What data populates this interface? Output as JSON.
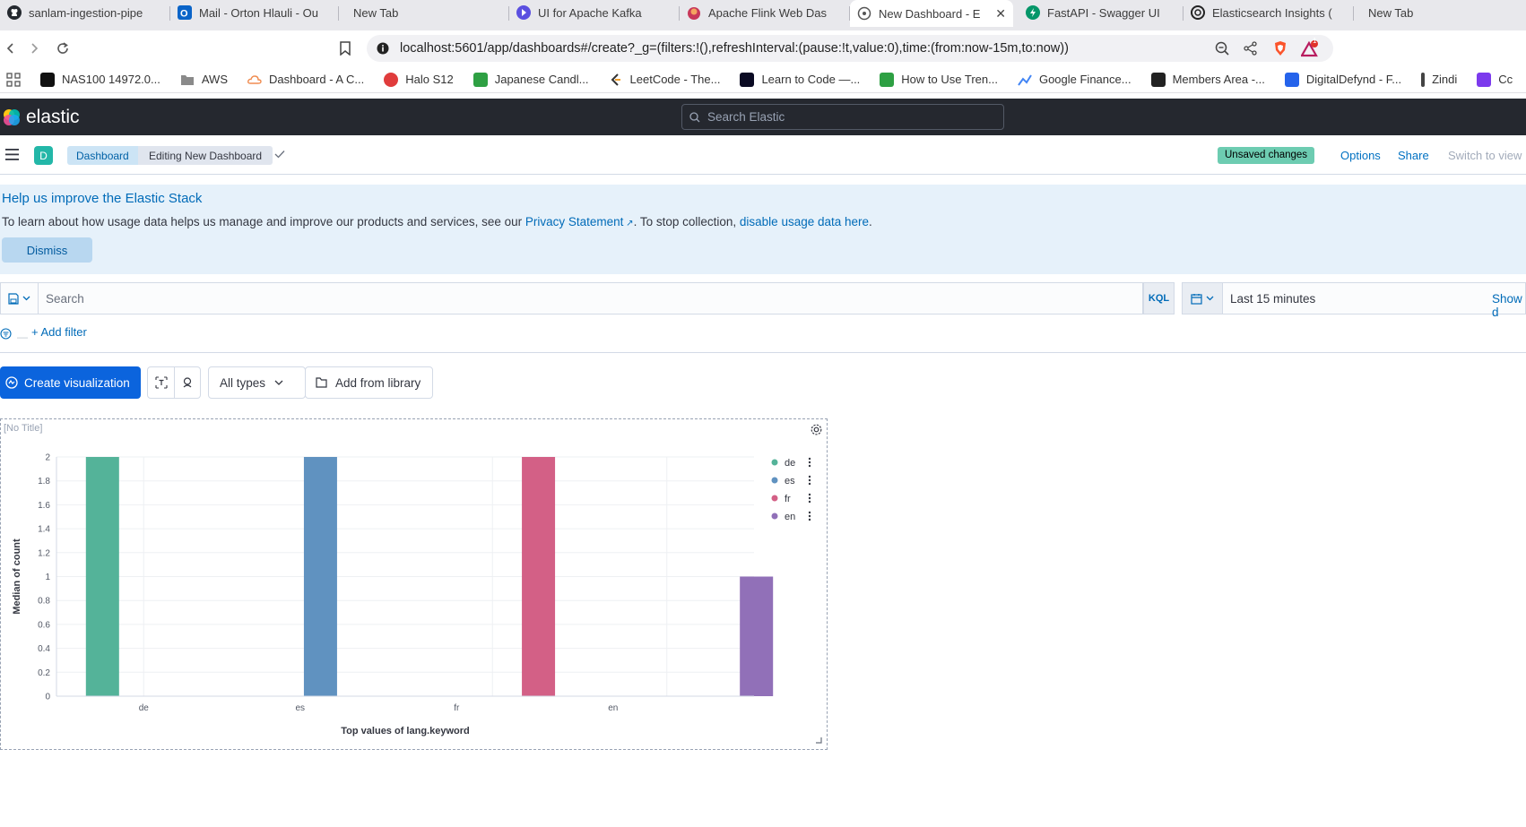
{
  "browser": {
    "tabs": [
      {
        "label": "sanlam-ingestion-pipe",
        "icon": "github-icon",
        "color": "#24292f",
        "active": false
      },
      {
        "label": "Mail - Orton Hlauli - Ou",
        "icon": "outlook-icon",
        "color": "#0a64c8",
        "active": false
      },
      {
        "label": "New Tab",
        "icon": "",
        "color": "",
        "active": false
      },
      {
        "label": "UI for Apache Kafka",
        "icon": "kafka-ui-icon",
        "color": "#5a4fe0",
        "active": false
      },
      {
        "label": "Apache Flink Web Das",
        "icon": "flink-icon",
        "color": "#c8385a",
        "active": false
      },
      {
        "label": "New Dashboard - E",
        "icon": "kibana-icon",
        "color": "#555555",
        "active": true
      },
      {
        "label": "FastAPI - Swagger UI",
        "icon": "fastapi-icon",
        "color": "#059669",
        "active": false
      },
      {
        "label": "Elasticsearch Insights (",
        "icon": "openai-icon",
        "color": "#222222",
        "active": false
      },
      {
        "label": "New Tab",
        "icon": "",
        "color": "",
        "active": false
      }
    ],
    "url": "localhost:5601/app/dashboards#/create?_g=(filters:!(),refreshInterval:(pause:!t,value:0),time:(from:now-15m,to:now))",
    "brave_badge": "1",
    "bookmarks": [
      {
        "label": "NAS100 14972.0...",
        "color": "#111111"
      },
      {
        "label": "AWS",
        "color": "#8a8a8a"
      },
      {
        "label": "Dashboard - A C...",
        "color": "#f08c50"
      },
      {
        "label": "Halo S12",
        "color": "#e03c3c"
      },
      {
        "label": "Japanese Candl...",
        "color": "#2ea043"
      },
      {
        "label": "LeetCode - The...",
        "color": "#333333"
      },
      {
        "label": "Learn to Code —...",
        "color": "#0a0a23"
      },
      {
        "label": "How to Use Tren...",
        "color": "#2ea043"
      },
      {
        "label": "Google Finance...",
        "color": "#4285f4"
      },
      {
        "label": "Members Area -...",
        "color": "#222222"
      },
      {
        "label": "DigitalDefynd - F...",
        "color": "#2563eb"
      },
      {
        "label": "Zindi",
        "color": "#444444"
      },
      {
        "label": "Cc",
        "color": "#7c3aed"
      }
    ]
  },
  "kibana": {
    "logo_text": "elastic",
    "global_search_placeholder": "Search Elastic",
    "space_initial": "D",
    "breadcrumbs": [
      "Dashboard",
      "Editing New Dashboard"
    ],
    "unsaved_badge": "Unsaved changes",
    "header_links": {
      "options": "Options",
      "share": "Share",
      "switch": "Switch to view"
    }
  },
  "callout": {
    "title": "Help us improve the Elastic Stack",
    "body_prefix": "To learn about how usage data helps us manage and improve our products and services, see our ",
    "privacy_link": "Privacy Statement",
    "body_middle": ". To stop collection, ",
    "disable_link": "disable usage data here",
    "body_suffix": ".",
    "dismiss": "Dismiss"
  },
  "query": {
    "placeholder": "Search",
    "language": "KQL",
    "time_range": "Last 15 minutes",
    "show_dates": "Show d",
    "add_filter": "+ Add filter"
  },
  "toolbar": {
    "create_visualization": "Create visualization",
    "all_types": "All types",
    "add_from_library": "Add from library"
  },
  "panel": {
    "title": "[No Title]"
  },
  "chart_data": {
    "type": "bar",
    "categories": [
      "de",
      "es",
      "fr",
      "en"
    ],
    "values": [
      2,
      2,
      2,
      1
    ],
    "colors": [
      "#54b399",
      "#6092c0",
      "#d36086",
      "#9170b8"
    ],
    "legend": [
      "de",
      "es",
      "fr",
      "en"
    ],
    "legend_position": "right",
    "xlabel": "Top values of lang.keyword",
    "ylabel": "Median of count",
    "ylim": [
      0,
      2
    ],
    "yticks": [
      "0",
      "0.2",
      "0.4",
      "0.6",
      "0.8",
      "1",
      "1.2",
      "1.4",
      "1.6",
      "1.8",
      "2"
    ],
    "grid": true
  }
}
